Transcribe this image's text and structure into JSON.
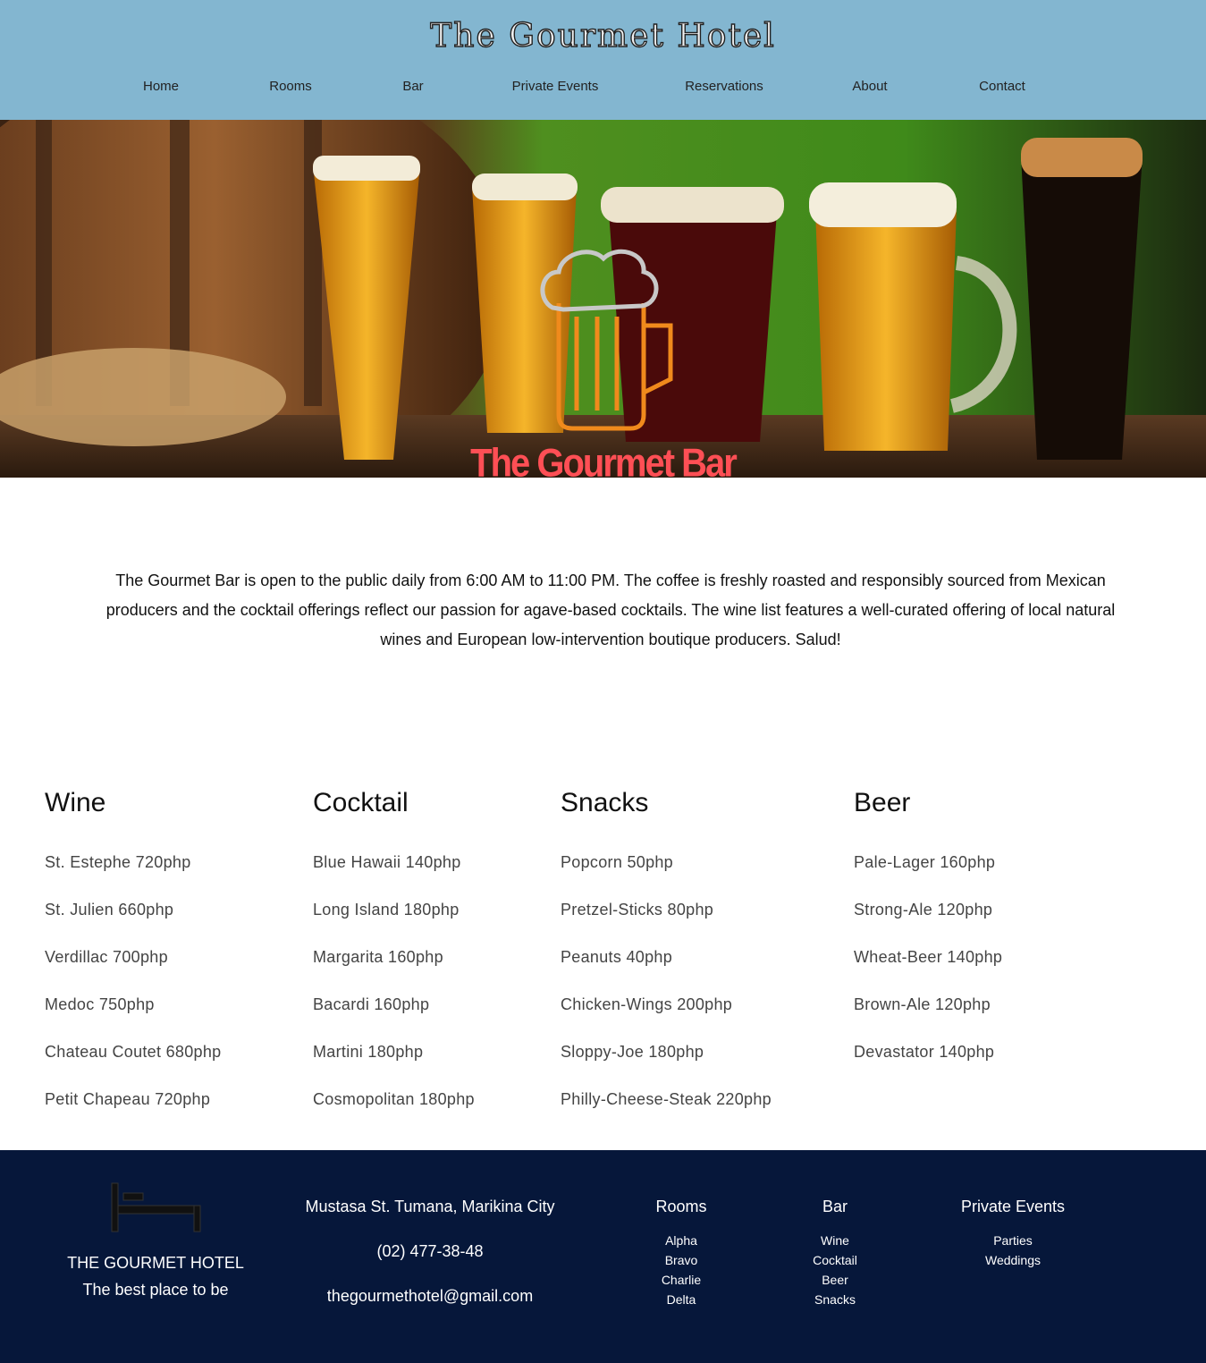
{
  "header": {
    "brand": "The Gourmet Hotel",
    "nav": [
      {
        "label": "Home"
      },
      {
        "label": "Rooms"
      },
      {
        "label": "Bar"
      },
      {
        "label": "Private Events"
      },
      {
        "label": "Reservations"
      },
      {
        "label": "About"
      },
      {
        "label": "Contact"
      }
    ]
  },
  "hero": {
    "title": "The Gourmet Bar",
    "icon": "beer-mug-icon"
  },
  "intro": {
    "text": "The Gourmet Bar is open to the public daily from 6:00 AM to 11:00 PM. The coffee is freshly roasted and responsibly sourced from Mexican producers and the cocktail offerings reflect our passion for agave-based cocktails. The wine list features a well-curated offering of local natural wines and European low-intervention boutique producers. Salud!"
  },
  "menu": {
    "wine": {
      "title": "Wine",
      "items": [
        "St. Estephe 720php",
        "St. Julien 660php",
        "Verdillac 700php",
        "Medoc 750php",
        "Chateau Coutet 680php",
        "Petit Chapeau 720php"
      ]
    },
    "cocktail": {
      "title": "Cocktail",
      "items": [
        "Blue Hawaii 140php",
        "Long Island 180php",
        "Margarita 160php",
        "Bacardi 160php",
        "Martini 180php",
        "Cosmopolitan 180php"
      ]
    },
    "snacks": {
      "title": "Snacks",
      "items": [
        "Popcorn 50php",
        "Pretzel-Sticks 80php",
        "Peanuts 40php",
        "Chicken-Wings 200php",
        "Sloppy-Joe 180php",
        "Philly-Cheese-Steak 220php"
      ]
    },
    "beer": {
      "title": "Beer",
      "items": [
        "Pale-Lager 160php",
        "Strong-Ale 120php",
        "Wheat-Beer 140php",
        "Brown-Ale 120php",
        "Devastator 140php"
      ]
    }
  },
  "footer": {
    "icon": "bed-icon",
    "hotel_name": "THE GOURMET HOTEL",
    "tagline": "The best place to be",
    "address": "Mustasa St. Tumana, Marikina City",
    "phone": "(02) 477-38-48",
    "email": "thegourmethotel@gmail.com",
    "rooms": {
      "title": "Rooms",
      "links": [
        "Alpha",
        "Bravo",
        "Charlie",
        "Delta"
      ]
    },
    "bar": {
      "title": "Bar",
      "links": [
        "Wine",
        "Cocktail",
        "Beer",
        "Snacks"
      ]
    },
    "events": {
      "title": "Private Events",
      "links": [
        "Parties",
        "Weddings"
      ]
    }
  },
  "colors": {
    "header_bg": "#83b6d0",
    "footer_bg": "#06173a",
    "hero_title": "#ff4f55",
    "beer_icon": "#f08a1c"
  }
}
